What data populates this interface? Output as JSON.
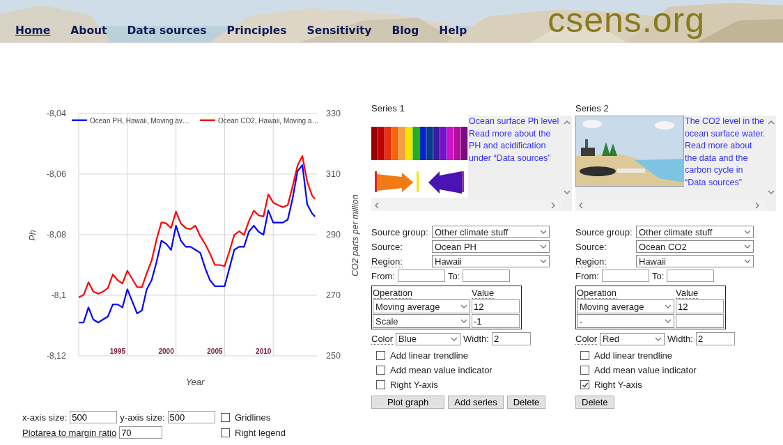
{
  "header": {
    "nav": [
      {
        "label": "Home",
        "selected": true
      },
      {
        "label": "About",
        "selected": false
      },
      {
        "label": "Data sources",
        "selected": false
      },
      {
        "label": "Principles",
        "selected": false
      },
      {
        "label": "Sensitivity",
        "selected": false
      },
      {
        "label": "Blog",
        "selected": false
      },
      {
        "label": "Help",
        "selected": false
      }
    ],
    "logo": "csens.org"
  },
  "chart": {
    "chart_data": {
      "type": "line",
      "grid": true,
      "legend": true,
      "xlabel": "Year",
      "ylabel": "Ph",
      "y2label": "CO2 parts per million",
      "xlim": [
        1991,
        2015.5
      ],
      "ylim": [
        -8.12,
        -8.04
      ],
      "y2lim": [
        250,
        330
      ],
      "xticks": [
        {
          "value": 1995,
          "label": "1995"
        },
        {
          "value": 2000,
          "label": "2000"
        },
        {
          "value": 2005,
          "label": "2005"
        },
        {
          "value": 2010,
          "label": "2010"
        }
      ],
      "yticks": [
        {
          "value": -8.04,
          "label": "-8,04"
        },
        {
          "value": -8.06,
          "label": "-8,06"
        },
        {
          "value": -8.08,
          "label": "-8,08"
        },
        {
          "value": -8.1,
          "label": "-8,1"
        },
        {
          "value": -8.12,
          "label": "-8,12"
        }
      ],
      "y2ticks": [
        {
          "value": 330,
          "label": "330"
        },
        {
          "value": 310,
          "label": "310"
        },
        {
          "value": 290,
          "label": "290"
        },
        {
          "value": 270,
          "label": "270"
        },
        {
          "value": 250,
          "label": "250"
        }
      ],
      "x": [
        1991,
        1991.5,
        1992,
        1992.5,
        1993,
        1993.5,
        1994,
        1994.5,
        1995,
        1995.5,
        1996,
        1996.5,
        1997,
        1997.5,
        1998,
        1998.5,
        1999,
        1999.5,
        2000,
        2000.5,
        2001,
        2001.5,
        2002,
        2002.5,
        2003,
        2003.5,
        2004,
        2004.5,
        2005,
        2005.5,
        2006,
        2006.5,
        2007,
        2007.5,
        2008,
        2008.5,
        2009,
        2009.5,
        2010,
        2010.5,
        2011,
        2011.5,
        2012,
        2012.5,
        2013,
        2013.5,
        2014,
        2014.5,
        2015,
        2015.3
      ],
      "series": [
        {
          "name": "Ocean PH, Hawaii, Moving av…",
          "color": "#0000ff",
          "values": [
            -8.109,
            -8.109,
            -8.104,
            -8.108,
            -8.109,
            -8.108,
            -8.107,
            -8.103,
            -8.103,
            -8.104,
            -8.098,
            -8.102,
            -8.106,
            -8.105,
            -8.098,
            -8.095,
            -8.089,
            -8.082,
            -8.083,
            -8.085,
            -8.077,
            -8.082,
            -8.084,
            -8.084,
            -8.085,
            -8.086,
            -8.091,
            -8.095,
            -8.097,
            -8.097,
            -8.097,
            -8.091,
            -8.085,
            -8.084,
            -8.084,
            -8.079,
            -8.077,
            -8.079,
            -8.08,
            -8.072,
            -8.076,
            -8.076,
            -8.076,
            -8.075,
            -8.068,
            -8.059,
            -8.057,
            -8.07,
            -8.073,
            -8.074
          ]
        },
        {
          "name": "Ocean CO2, Hawaii, Moving a…",
          "color": "#ff0000",
          "axis": "y2",
          "values": [
            269.3,
            270.1,
            274.3,
            271.2,
            270.5,
            271.2,
            272.4,
            276.9,
            275.0,
            273.9,
            278.1,
            275.4,
            272.7,
            272.7,
            277.3,
            281.5,
            288.4,
            294.1,
            293.7,
            292.2,
            297.6,
            293.7,
            292.2,
            291.8,
            293.0,
            289.5,
            286.9,
            283.8,
            280.0,
            280.0,
            279.6,
            284.6,
            289.9,
            291.1,
            289.9,
            294.5,
            297.9,
            296.4,
            296.0,
            303.3,
            300.6,
            299.8,
            299.1,
            299.8,
            306.0,
            312.8,
            316.0,
            307.5,
            302.9,
            301.8
          ]
        }
      ]
    }
  },
  "series_panels": [
    {
      "title": "Series 1",
      "info": [
        "Ocean surface Ph level",
        "Read more about the PH and acidification under “Data sources”"
      ],
      "fields": [
        {
          "label": "Source group:",
          "value": "Other climate stuff",
          "underlined": false
        },
        {
          "label": "Source:",
          "value": "Ocean PH",
          "underlined": false
        },
        {
          "label": "Region:",
          "value": "Hawaii",
          "underlined": true
        }
      ],
      "from": {
        "label": "From:"
      },
      "to": {
        "label": "To:"
      },
      "operations": {
        "headers": [
          "Operation",
          "Value"
        ],
        "rows": [
          {
            "operation": "Moving average",
            "value": "12"
          },
          {
            "operation": "Scale",
            "value": "-1"
          }
        ]
      },
      "color": {
        "label": "Color",
        "value": "Blue"
      },
      "width": {
        "label": "Width:",
        "value": "2"
      },
      "options": [
        {
          "label": "Add linear trendline",
          "checked": false
        },
        {
          "label": "Add mean value indicator",
          "checked": false
        },
        {
          "label": "Right Y-axis",
          "checked": false
        }
      ],
      "buttons": [
        "Plot graph",
        "Add series",
        "Delete"
      ]
    },
    {
      "title": "Series 2",
      "info": [
        "The CO2 level in the ocean surface water.",
        "Read more about the data and the carbon cycle in “Data sources”"
      ],
      "fields": [
        {
          "label": "Source group:",
          "value": "Other climate stuff",
          "underlined": false
        },
        {
          "label": "Source:",
          "value": "Ocean CO2",
          "underlined": false
        },
        {
          "label": "Region:",
          "value": "Hawaii",
          "underlined": true
        }
      ],
      "from": {
        "label": "From:"
      },
      "to": {
        "label": "To:"
      },
      "operations": {
        "headers": [
          "Operation",
          "Value"
        ],
        "rows": [
          {
            "operation": "Moving average",
            "value": "12"
          },
          {
            "operation": "-"
          }
        ]
      },
      "color": {
        "label": "Color",
        "value": "Red"
      },
      "width": {
        "label": "Width:",
        "value": "2"
      },
      "options": [
        {
          "label": "Add linear trendline",
          "checked": false
        },
        {
          "label": "Add mean value indicator",
          "checked": false
        },
        {
          "label": "Right Y-axis",
          "checked": true
        }
      ],
      "buttons": [
        "Delete"
      ]
    }
  ],
  "plot_settings": {
    "x_axis_size": {
      "label": "x-axis size:",
      "value": "500"
    },
    "y_axis_size": {
      "label": "y-axis size:",
      "value": "500"
    },
    "ratio": {
      "label": "Plotarea to margin ratio",
      "value": "70"
    },
    "options": [
      {
        "label": "Gridlines",
        "checked": false
      },
      {
        "label": "Right legend",
        "checked": false
      }
    ]
  }
}
